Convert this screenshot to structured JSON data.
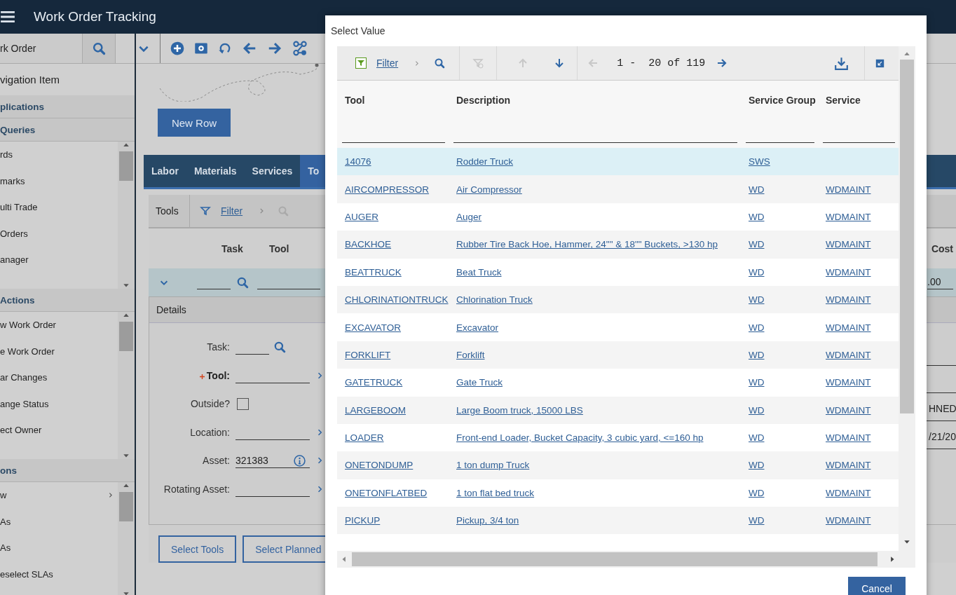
{
  "header": {
    "title": "Work Order Tracking"
  },
  "toolbar": {
    "search_value": "rk Order"
  },
  "sidebar": {
    "items": [
      {
        "kind": "item",
        "label": "vigation Item"
      },
      {
        "kind": "heading",
        "label": "plications"
      },
      {
        "kind": "heading",
        "label": "Queries"
      },
      {
        "kind": "list",
        "items": [
          {
            "label": "rds",
            "submenu": false
          },
          {
            "label": "marks",
            "submenu": false
          },
          {
            "label": "ulti Trade",
            "submenu": false
          },
          {
            "label": "Orders",
            "submenu": false
          },
          {
            "label": "anager",
            "submenu": false
          }
        ]
      },
      {
        "kind": "heading",
        "label": "Actions"
      },
      {
        "kind": "list",
        "items": [
          {
            "label": "w Work Order",
            "submenu": false
          },
          {
            "label": "e Work Order",
            "submenu": false
          },
          {
            "label": "ar Changes",
            "submenu": false
          },
          {
            "label": "ange Status",
            "submenu": false
          },
          {
            "label": "ect Owner",
            "submenu": false
          }
        ]
      },
      {
        "kind": "heading",
        "label": "ons"
      },
      {
        "kind": "list",
        "items": [
          {
            "label": "w",
            "submenu": true
          },
          {
            "label": "As",
            "submenu": false
          },
          {
            "label": "As",
            "submenu": false
          },
          {
            "label": "eselect SLAs",
            "submenu": false
          }
        ]
      }
    ]
  },
  "main": {
    "new_row_button": "New Row",
    "tabs": [
      {
        "label": "Labor",
        "selected": false
      },
      {
        "label": "Materials",
        "selected": false
      },
      {
        "label": "Services",
        "selected": false
      },
      {
        "label": "To",
        "selected": true
      }
    ],
    "tools_table": {
      "title": "Tools",
      "filter_label": "Filter",
      "columns": [
        "Task",
        "Tool",
        "Cost"
      ],
      "row_cost": ".00"
    },
    "details": {
      "title": "Details",
      "fields": [
        {
          "label": "Task:",
          "kind": "lookup",
          "required": false,
          "info": false
        },
        {
          "label": "Tool:",
          "kind": "menu",
          "required": true,
          "info": false
        },
        {
          "label": "Outside?",
          "kind": "checkbox",
          "checked": false,
          "required": false,
          "info": false
        },
        {
          "label": "Location:",
          "kind": "menu",
          "required": false,
          "info": false
        },
        {
          "label": "Asset:",
          "kind": "menu",
          "value": "321383",
          "required": false,
          "info": true
        },
        {
          "label": "Rotating Asset:",
          "kind": "menu",
          "required": false,
          "info": false
        }
      ],
      "right_values": [
        "HNED",
        "/21/20"
      ]
    },
    "buttons": [
      "Select Tools",
      "Select Planned"
    ]
  },
  "dialog": {
    "title": "Select Value",
    "filter_label": "Filter",
    "clear_filter_disabled": true,
    "sort_buttons": [
      {
        "kind": "up",
        "disabled": true
      },
      {
        "kind": "down",
        "disabled": false
      }
    ],
    "page_buttons": [
      {
        "kind": "prev",
        "disabled": true
      },
      {
        "kind": "next",
        "disabled": false
      }
    ],
    "range": "1 -  20 of 119",
    "columns": [
      "Tool",
      "Description",
      "Service Group",
      "Service"
    ],
    "rows": [
      {
        "cells": [
          "14076",
          "Rodder Truck",
          "SWS"
        ],
        "selected": true
      },
      {
        "cells": [
          "AIRCOMPRESSOR",
          "Air Compressor",
          "WD",
          "WDMAINT"
        ],
        "selected": false
      },
      {
        "cells": [
          "AUGER",
          "Auger",
          "WD",
          "WDMAINT"
        ],
        "selected": false
      },
      {
        "cells": [
          "BACKHOE",
          "Rubber Tire Back Hoe, Hammer, 24\"\" & 18\"\" Buckets, >130 hp",
          "WD",
          "WDMAINT"
        ],
        "selected": false
      },
      {
        "cells": [
          "BEATTRUCK",
          "Beat Truck",
          "WD",
          "WDMAINT"
        ],
        "selected": false
      },
      {
        "cells": [
          "CHLORINATIONTRUCK",
          "Chlorination Truck",
          "WD",
          "WDMAINT"
        ],
        "selected": false
      },
      {
        "cells": [
          "EXCAVATOR",
          "Excavator",
          "WD",
          "WDMAINT"
        ],
        "selected": false
      },
      {
        "cells": [
          "FORKLIFT",
          "Forklift",
          "WD",
          "WDMAINT"
        ],
        "selected": false
      },
      {
        "cells": [
          "GATETRUCK",
          "Gate Truck",
          "WD",
          "WDMAINT"
        ],
        "selected": false
      },
      {
        "cells": [
          "LARGEBOOM",
          "Large Boom truck, 15000 LBS",
          "WD",
          "WDMAINT"
        ],
        "selected": false
      },
      {
        "cells": [
          "LOADER",
          "Front-end Loader, Bucket Capacity, 3 cubic yard, <=160 hp",
          "WD",
          "WDMAINT"
        ],
        "selected": false
      },
      {
        "cells": [
          "ONETONDUMP",
          "1 ton dump Truck",
          "WD",
          "WDMAINT"
        ],
        "selected": false
      },
      {
        "cells": [
          "ONETONFLATBED",
          "1 ton flat bed truck",
          "WD",
          "WDMAINT"
        ],
        "selected": false
      },
      {
        "cells": [
          "PICKUP",
          "Pickup, 3/4 ton",
          "WD",
          "WDMAINT"
        ],
        "selected": false
      }
    ],
    "buttons": [
      "Cancel"
    ]
  }
}
